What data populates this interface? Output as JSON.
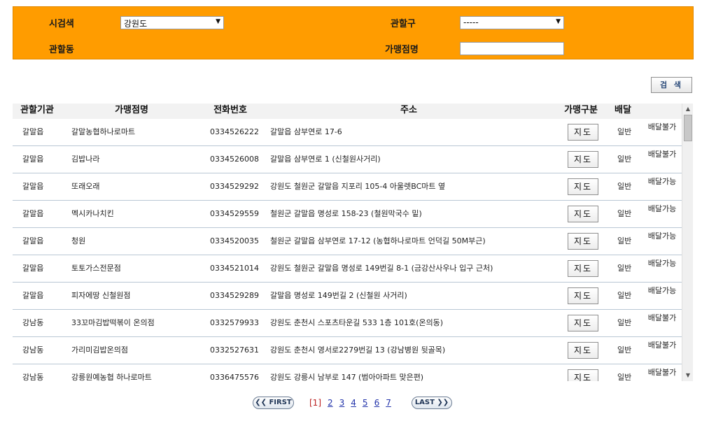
{
  "search": {
    "city_label": "시검색",
    "city_value": "강원도",
    "district_label": "관할구",
    "district_value": "-----",
    "dong_label": "관할동",
    "store_label": "가맹점명",
    "store_value": "",
    "button_label": "검 색"
  },
  "table": {
    "headers": {
      "agency": "관할기관",
      "store": "가맹점명",
      "phone": "전화번호",
      "address": "주소",
      "type": "가맹구분",
      "delivery": "배달"
    },
    "rows": [
      {
        "agency": "갈말읍",
        "store": "갈말농협하나로마트",
        "phone": "0334526222",
        "address": "갈말읍 삼부연로 17-6",
        "map": "지도",
        "type": "일반",
        "delivery": "배달불가"
      },
      {
        "agency": "갈말읍",
        "store": "김밥나라",
        "phone": "0334526008",
        "address": "갈말읍 삼부연로 1 (신철원사거리)",
        "map": "지도",
        "type": "일반",
        "delivery": "배달불가"
      },
      {
        "agency": "갈말읍",
        "store": "또래오래",
        "phone": "0334529292",
        "address": "강원도 철원군 갈말읍 지포리 105-4 아울렛BC마트 옆",
        "map": "지도",
        "type": "일반",
        "delivery": "배달가능"
      },
      {
        "agency": "갈말읍",
        "store": "멕시카나치킨",
        "phone": "0334529559",
        "address": "철원군 갈말읍 명성로 158-23 (철원막국수 밑)",
        "map": "지도",
        "type": "일반",
        "delivery": "배달가능"
      },
      {
        "agency": "갈말읍",
        "store": "청원",
        "phone": "0334520035",
        "address": "철원군 갈말읍 삼부연로 17-12 (농협하나로마트 언덕길 50M부근)",
        "map": "지도",
        "type": "일반",
        "delivery": "배달가능"
      },
      {
        "agency": "갈말읍",
        "store": "토토가스전문점",
        "phone": "0334521014",
        "address": "강원도 철원군 갈말읍 명성로 149번길 8-1 (금강산사우나 입구 근처)",
        "map": "지도",
        "type": "일반",
        "delivery": "배달가능"
      },
      {
        "agency": "갈말읍",
        "store": "피자에땅 신철원점",
        "phone": "0334529289",
        "address": "갈말읍 명성로 149번길 2 (신철원 사거리)",
        "map": "지도",
        "type": "일반",
        "delivery": "배달가능"
      },
      {
        "agency": "강남동",
        "store": "33꼬마김밥떡볶이 온의점",
        "phone": "0332579933",
        "address": "강원도 춘천시 스포츠타운길 533 1층 101호(온의동)",
        "map": "지도",
        "type": "일반",
        "delivery": "배달불가"
      },
      {
        "agency": "강남동",
        "store": "가리미김밥온의점",
        "phone": "0332527631",
        "address": "강원도 춘천시 영서로2279번길 13 (강남병원 뒷골목)",
        "map": "지도",
        "type": "일반",
        "delivery": "배달불가"
      },
      {
        "agency": "강남동",
        "store": "강릉원예농협 하나로마트",
        "phone": "0336475576",
        "address": "강원도 강릉시 남부로 147 (범아아파트 맞은편)",
        "map": "지도",
        "type": "일반",
        "delivery": "배달불가"
      }
    ]
  },
  "pagination": {
    "first_label": "❮❮ FIRST",
    "last_label": "LAST ❯❯",
    "pages": [
      "[1]",
      "2",
      "3",
      "4",
      "5",
      "6",
      "7"
    ]
  },
  "colors": {
    "panel": "#ff9c00",
    "row_border": "#b9c7d4"
  }
}
